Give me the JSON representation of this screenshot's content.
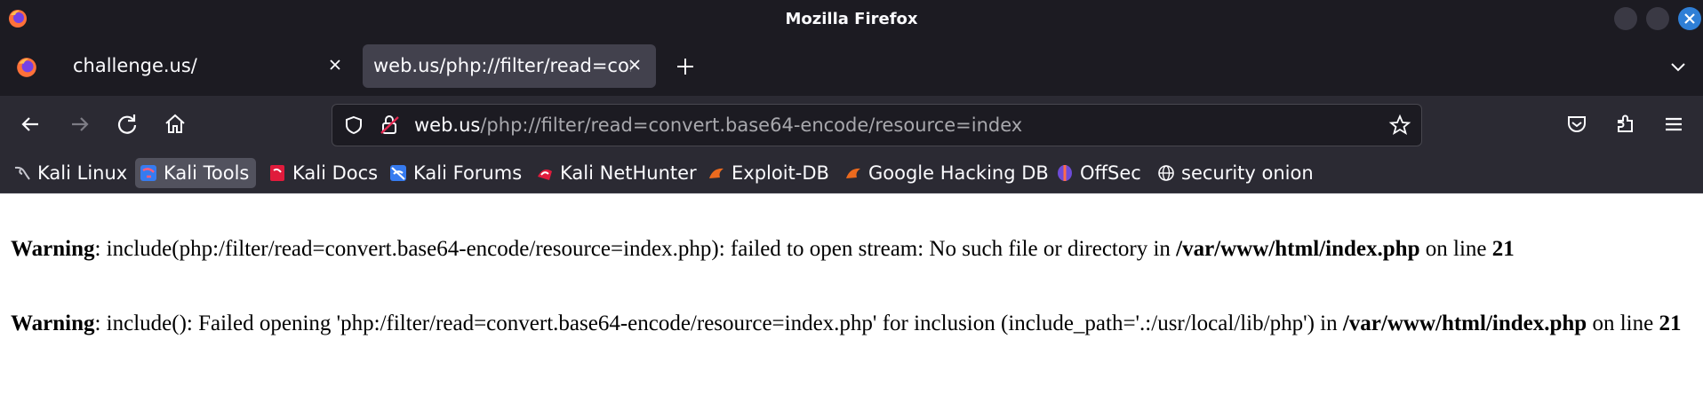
{
  "window": {
    "title": "Mozilla Firefox",
    "close_color": "#2f7fd6"
  },
  "tabs": [
    {
      "title": "challenge.us/",
      "active": false
    },
    {
      "title": "web.us/php://filter/read=con",
      "active": true
    }
  ],
  "navbar": {
    "url_host": "web.us",
    "url_path": "/php://filter/read=convert.base64-encode/resource=index",
    "icons": [
      "back-arrow-icon",
      "forward-arrow-icon",
      "reload-icon",
      "home-icon",
      "shield-icon",
      "insecure-lock-icon",
      "star-icon",
      "pocket-icon",
      "extensions-icon",
      "menu-icon"
    ]
  },
  "bookmarks": [
    {
      "label": "Kali Linux",
      "icon": "kali-dragon-icon"
    },
    {
      "label": "Kali Tools",
      "icon": "kali-tools-icon"
    },
    {
      "label": "Kali Docs",
      "icon": "kali-docs-icon"
    },
    {
      "label": "Kali Forums",
      "icon": "kali-forums-icon"
    },
    {
      "label": "Kali NetHunter",
      "icon": "kali-nethunter-icon"
    },
    {
      "label": "Exploit-DB",
      "icon": "exploit-db-icon"
    },
    {
      "label": "Google Hacking DB",
      "icon": "ghdb-icon"
    },
    {
      "label": "OffSec",
      "icon": "offsec-icon"
    },
    {
      "label": "security onion",
      "icon": "globe-icon"
    }
  ],
  "content": {
    "warning1": {
      "label": "Warning",
      "text": ": include(php:/filter/read=convert.base64-encode/resource=index.php): failed to open stream: No such file or directory in ",
      "file": "/var/www/html/index.php",
      "on_line": " on line ",
      "line": "21"
    },
    "warning2": {
      "label": "Warning",
      "text": ": include(): Failed opening 'php:/filter/read=convert.base64-encode/resource=index.php' for inclusion (include_path='.:/usr/local/lib/php') in ",
      "file": "/var/www/html/index.php",
      "on_line": " on line ",
      "line": "21"
    }
  }
}
